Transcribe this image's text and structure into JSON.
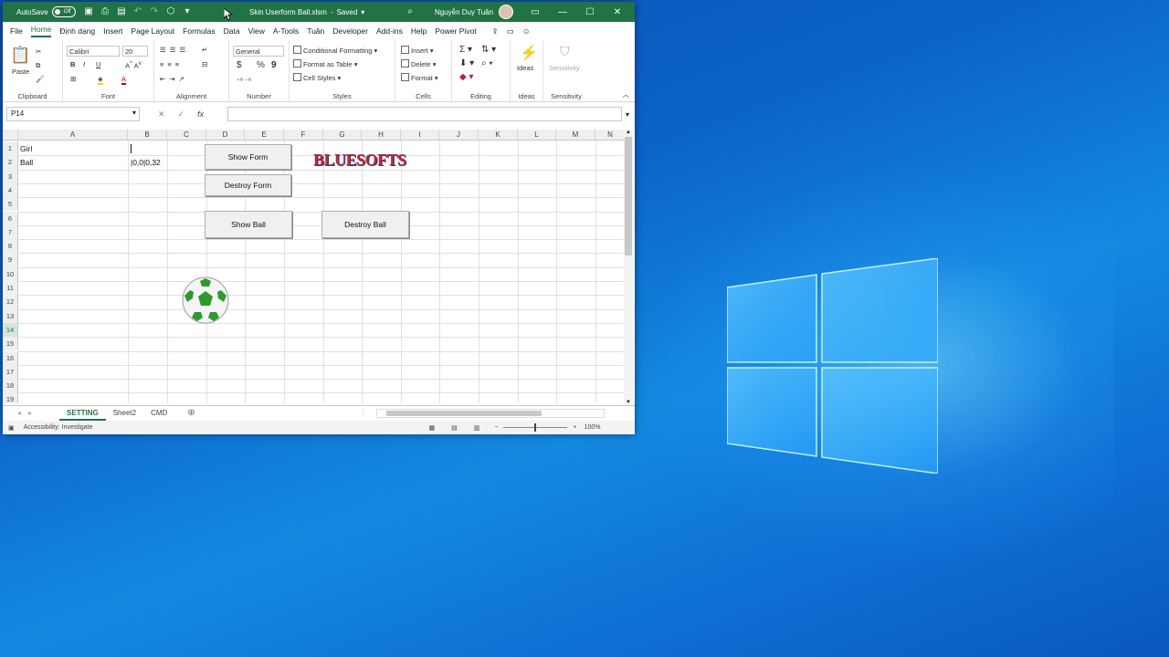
{
  "titlebar": {
    "autosave_label": "AutoSave",
    "autosave_state": "Off",
    "filename": "Skin Userform Ball.xlsm",
    "saved": "Saved",
    "user": "Nguyễn Duy Tuân"
  },
  "menu": [
    "File",
    "Home",
    "Định dạng",
    "Insert",
    "Page Layout",
    "Formulas",
    "Data",
    "View",
    "A-Tools",
    "Tuân",
    "Developer",
    "Add-ins",
    "Help",
    "Power Pivot"
  ],
  "ribbon": {
    "clipboard": {
      "paste": "Paste",
      "label": "Clipboard"
    },
    "font": {
      "name": "Calibri",
      "size": "20",
      "label": "Font",
      "bold": "B",
      "italic": "I",
      "underline": "U"
    },
    "alignment": {
      "label": "Alignment"
    },
    "number": {
      "format": "General",
      "label": "Number",
      "currency": "$",
      "percent": "%",
      "comma": "9"
    },
    "styles": {
      "cond": "Conditional Formatting",
      "table": "Format as Table",
      "cell": "Cell Styles",
      "label": "Styles"
    },
    "cells": {
      "insert": "Insert",
      "delete": "Delete",
      "format": "Format",
      "label": "Cells"
    },
    "editing": {
      "label": "Editing"
    },
    "ideas": {
      "btn": "Ideas",
      "label": "Ideas"
    },
    "sensitivity": {
      "btn": "Sensitivity",
      "label": "Sensitivity"
    }
  },
  "formula_bar": {
    "name_box": "P14",
    "fx": "fx",
    "value": ""
  },
  "columns": [
    "A",
    "B",
    "C",
    "D",
    "E",
    "F",
    "G",
    "H",
    "I",
    "J",
    "K",
    "L",
    "M",
    "N"
  ],
  "rows": [
    "1",
    "2",
    "3",
    "4",
    "5",
    "6",
    "7",
    "8",
    "9",
    "10",
    "11",
    "12",
    "13",
    "14",
    "15",
    "16",
    "17",
    "18",
    "19"
  ],
  "cells": {
    "a1": "Girl",
    "a2": "Ball",
    "b2": "|0,0|0,32"
  },
  "buttons": {
    "show_form": "Show Form",
    "destroy_form": "Destroy Form",
    "show_ball": "Show Ball",
    "destroy_ball": "Destroy Ball"
  },
  "logo": "BLUESOFTS",
  "tabs": [
    "SETTING",
    "Sheet2",
    "CMD"
  ],
  "status": {
    "accessibility": "Accessibility: Investigate",
    "zoom": "100%"
  }
}
